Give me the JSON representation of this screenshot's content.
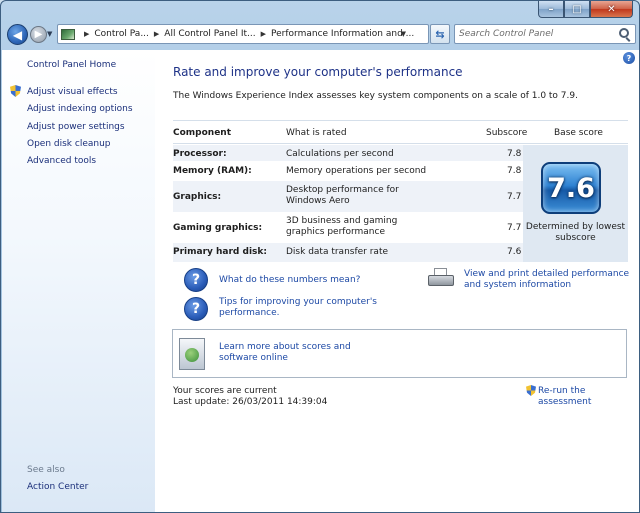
{
  "window": {
    "caption_buttons": {
      "minimize": "–",
      "maximize": "□",
      "close": "✕"
    }
  },
  "nav": {
    "back_icon": "back-arrow",
    "forward_icon": "forward-arrow",
    "breadcrumbs": [
      "Control Pa...",
      "All Control Panel It...",
      "Performance Information and ..."
    ],
    "refresh_icon": "refresh-arrows",
    "search_placeholder": "Search Control Panel"
  },
  "sidebar": {
    "home": "Control Panel Home",
    "links": [
      "Adjust visual effects",
      "Adjust indexing options",
      "Adjust power settings",
      "Open disk cleanup",
      "Advanced tools"
    ],
    "see_also_label": "See also",
    "see_also_links": [
      "Action Center"
    ]
  },
  "main": {
    "title": "Rate and improve your computer's performance",
    "intro": "The Windows Experience Index assesses key system components on a scale of 1.0 to 7.9.",
    "table": {
      "headers": {
        "component": "Component",
        "rated": "What is rated",
        "subscore": "Subscore",
        "base": "Base score"
      },
      "rows": [
        {
          "component": "Processor:",
          "rated": "Calculations per second",
          "subscore": "7.8"
        },
        {
          "component": "Memory (RAM):",
          "rated": "Memory operations per second",
          "subscore": "7.8"
        },
        {
          "component": "Graphics:",
          "rated": "Desktop performance for Windows Aero",
          "subscore": "7.7"
        },
        {
          "component": "Gaming graphics:",
          "rated": "3D business and gaming graphics performance",
          "subscore": "7.7"
        },
        {
          "component": "Primary hard disk:",
          "rated": "Disk data transfer rate",
          "subscore": "7.6"
        }
      ]
    },
    "base_score": {
      "value": "7.6",
      "caption": "Determined by lowest subscore",
      "badge_color": "#2e82d2"
    },
    "links": {
      "numbers_mean": "What do these numbers mean?",
      "tips": "Tips for improving your computer's performance.",
      "view_print": "View and print detailed performance and system information",
      "learn_more": "Learn more about scores and software online",
      "rerun": "Re-run the assessment"
    },
    "status": {
      "current": "Your scores are current",
      "last_update": "Last update: 26/03/2011 14:39:04"
    }
  }
}
